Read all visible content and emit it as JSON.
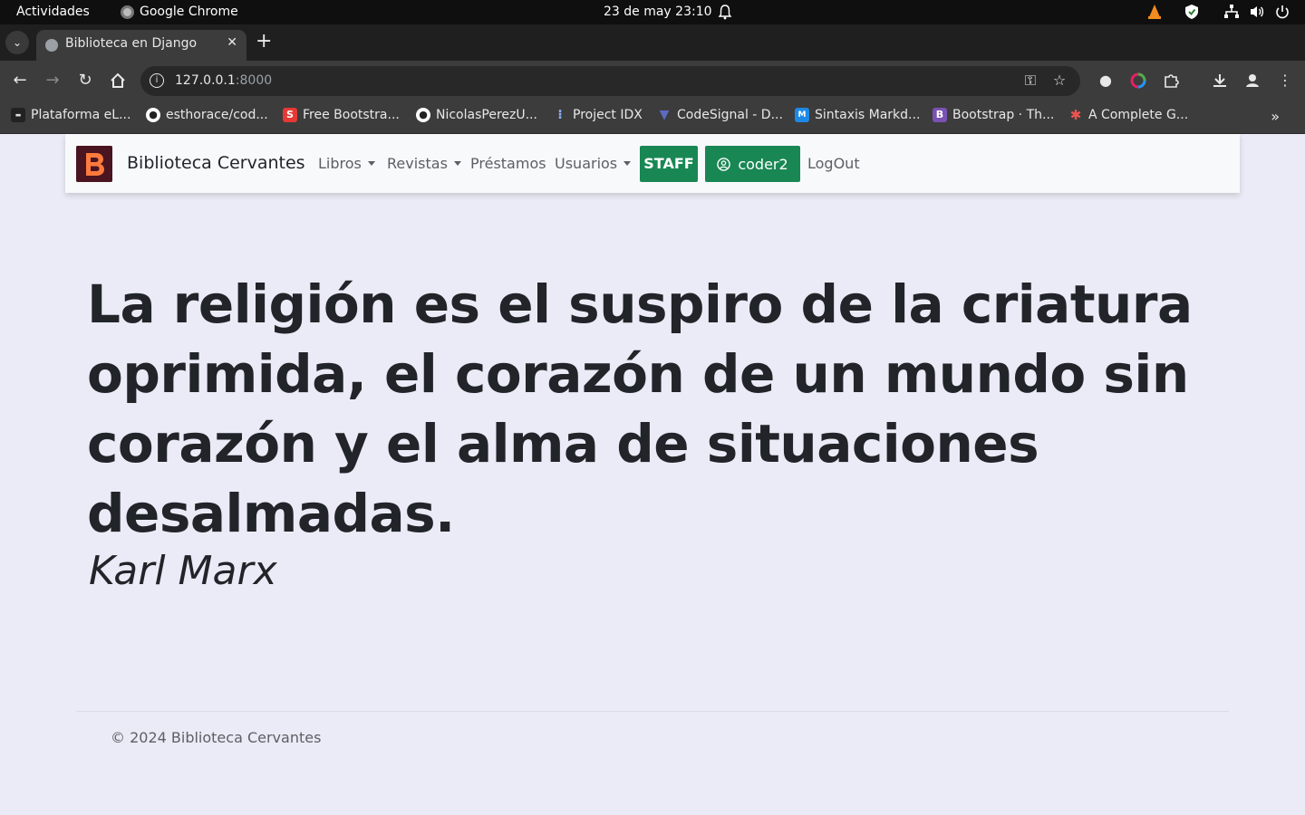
{
  "system": {
    "activities": "Actividades",
    "app_name": "Google Chrome",
    "clock": "23 de may  23:10"
  },
  "browser": {
    "tab_title": "Biblioteca en Django",
    "url_host": "127.0.0.1",
    "url_port": ":8000",
    "bookmarks": [
      {
        "label": "Plataforma eL...",
        "color": "#ffffff"
      },
      {
        "label": "esthorace/cod...",
        "color": "#ffffff"
      },
      {
        "label": "Free Bootstra...",
        "color": "#e53935"
      },
      {
        "label": "NicolasPerezU...",
        "color": "#ffffff"
      },
      {
        "label": "Project IDX",
        "color": "#8ab4f8"
      },
      {
        "label": "CodeSignal - D...",
        "color": "#3f51b5"
      },
      {
        "label": "Sintaxis Markd...",
        "color": "#1e88e5"
      },
      {
        "label": "Bootstrap · Th...",
        "color": "#7952b3"
      },
      {
        "label": "A Complete G...",
        "color": "#ef5350"
      }
    ]
  },
  "site": {
    "brand": "Biblioteca Cervantes",
    "nav": {
      "libros": "Libros",
      "revistas": "Revistas",
      "prestamos": "Préstamos",
      "usuarios": "Usuarios",
      "staff": "STAFF",
      "user": "coder2",
      "logout": "LogOut"
    },
    "quote": "La religión es el suspiro de la criatura oprimida, el corazón de un mundo sin corazón y el alma de situaciones desalmadas.",
    "author": "Karl Marx",
    "footer": "© 2024 Biblioteca Cervantes",
    "colors": {
      "background": "#ebebf7",
      "success": "#198754",
      "navbar": "#f8f9fa"
    }
  }
}
